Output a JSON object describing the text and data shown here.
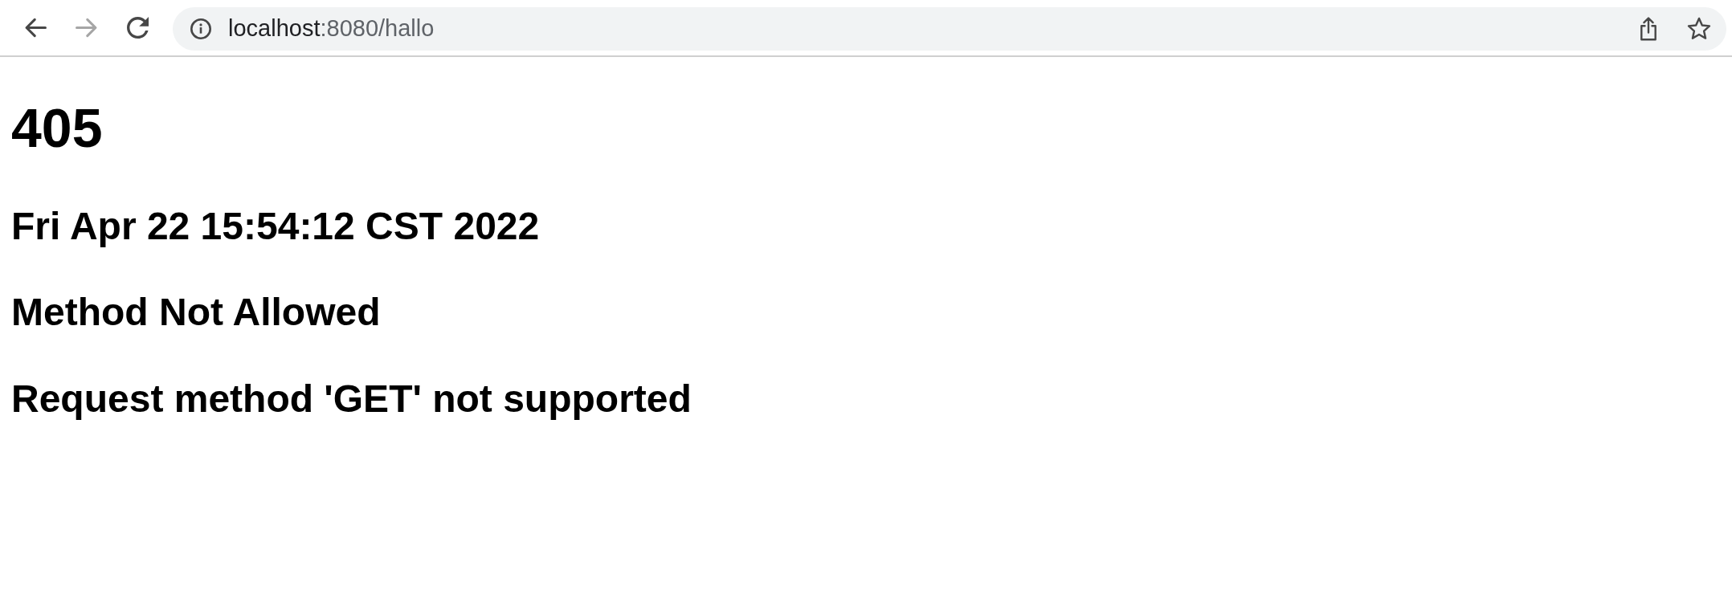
{
  "toolbar": {
    "buttons": [
      {
        "kind": "back",
        "disabled": false
      },
      {
        "kind": "forward",
        "disabled": true
      },
      {
        "kind": "reload",
        "disabled": false
      }
    ],
    "address_bar": {
      "host": "localhost",
      "path": ":8080/hallo"
    },
    "actions": [
      {
        "kind": "share"
      },
      {
        "kind": "bookmark"
      }
    ]
  },
  "page": {
    "lines": [
      {
        "kind": "title",
        "text": "405"
      },
      {
        "kind": "subtitle",
        "text": "Fri Apr 22 15:54:12 CST 2022"
      },
      {
        "kind": "subtitle",
        "text": "Method Not Allowed"
      },
      {
        "kind": "subtitle",
        "text": "Request method 'GET' not supported"
      }
    ]
  }
}
